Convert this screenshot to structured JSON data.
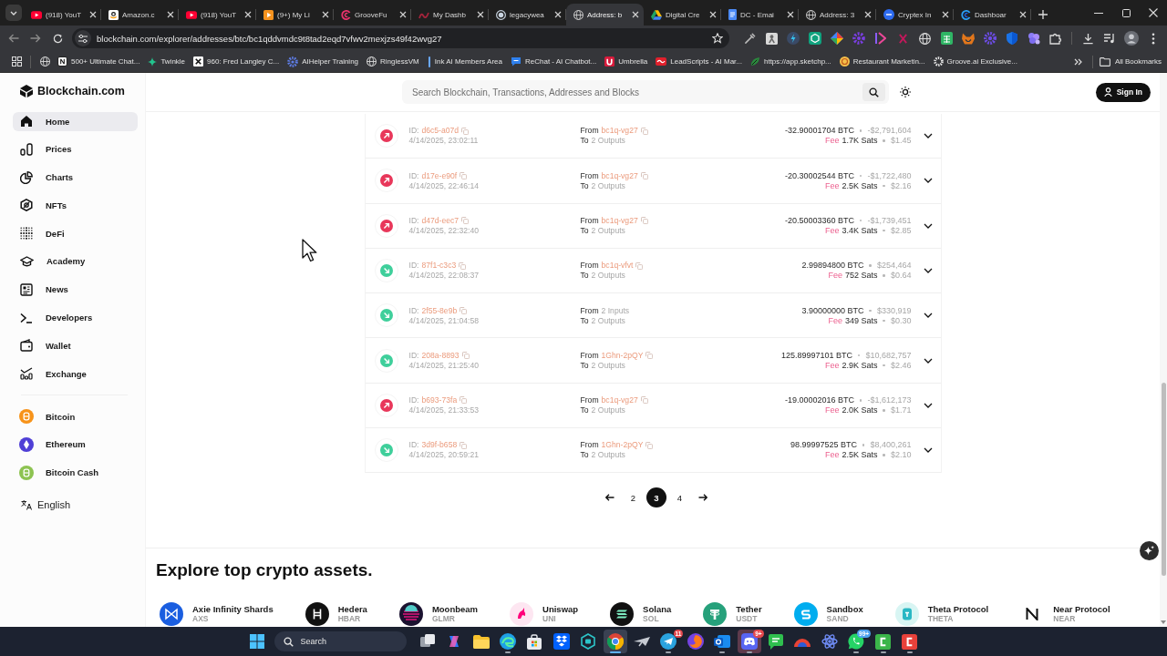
{
  "browser": {
    "tabs": [
      {
        "label": "(918) YouT",
        "selected": false
      },
      {
        "label": "Amazon.c",
        "selected": false
      },
      {
        "label": "(918) YouT",
        "selected": false
      },
      {
        "label": "(9+) My Li",
        "selected": false
      },
      {
        "label": "GrooveFu",
        "selected": false
      },
      {
        "label": "My Dashb",
        "selected": false
      },
      {
        "label": "legacywea",
        "selected": false
      },
      {
        "label": "Address: b",
        "selected": true
      },
      {
        "label": "Digital Cre",
        "selected": false
      },
      {
        "label": "DC - Emai",
        "selected": false
      },
      {
        "label": "Address: 3",
        "selected": false
      },
      {
        "label": "Cryptex In",
        "selected": false
      },
      {
        "label": "Dashboar",
        "selected": false
      }
    ],
    "url": "blockchain.com/explorer/addresses/btc/bc1qddvmdc9t8tad2eqd7vfwv2mexjzs49f42wvg27",
    "bookmarks": [
      "500+ Ultimate Chat...",
      "Twinkle",
      "960: Fred Langley C...",
      "AIHelper Training",
      "RinglessVM",
      "Ink AI Members Area",
      "ReChat - AI Chatbot...",
      "Umbrella",
      "LeadScripts - AI Mar...",
      "https://app.sketchp...",
      "Restaurant Marketin...",
      "Groove.ai Exclusive..."
    ],
    "all_bookmarks": "All Bookmarks"
  },
  "sidebar": {
    "logo": "Blockchain.com",
    "items": [
      {
        "label": "Home",
        "selected": true
      },
      {
        "label": "Prices",
        "selected": false
      },
      {
        "label": "Charts",
        "selected": false
      },
      {
        "label": "NFTs",
        "selected": false
      },
      {
        "label": "DeFi",
        "selected": false
      },
      {
        "label": "Academy",
        "selected": false
      },
      {
        "label": "News",
        "selected": false
      },
      {
        "label": "Developers",
        "selected": false
      },
      {
        "label": "Wallet",
        "selected": false
      },
      {
        "label": "Exchange",
        "selected": false
      }
    ],
    "coins": [
      {
        "name": "Bitcoin",
        "color": "#f7931a"
      },
      {
        "name": "Ethereum",
        "color": "#4f3fd6"
      },
      {
        "name": "Bitcoin Cash",
        "color": "#8dc351"
      }
    ],
    "language": "English"
  },
  "header": {
    "search": {
      "placeholder": "Search Blockchain, Transactions, Addresses and Blocks"
    },
    "sign_in": "Sign In"
  },
  "transactions": [
    {
      "kind": "sent",
      "id_label": "ID:",
      "id": "d6c5-a07d",
      "time": "4/14/2025, 23:02:11",
      "from_label": "From",
      "from": "bc1q-vg27",
      "from_is_address": true,
      "to_label": "To",
      "to": "2 Outputs",
      "amount": "-32.90001704 BTC",
      "value": "-$2,791,604",
      "fee_label": "Fee",
      "fee": "1.7K Sats",
      "fee_value": "$1.45",
      "expanded": false
    },
    {
      "kind": "sent",
      "id_label": "ID:",
      "id": "d17e-e90f",
      "time": "4/14/2025, 22:46:14",
      "from_label": "From",
      "from": "bc1q-vg27",
      "from_is_address": true,
      "to_label": "To",
      "to": "2 Outputs",
      "amount": "-20.30002544 BTC",
      "value": "-$1,722,480",
      "fee_label": "Fee",
      "fee": "2.5K Sats",
      "fee_value": "$2.16",
      "expanded": false
    },
    {
      "kind": "sent",
      "id_label": "ID:",
      "id": "d47d-eec7",
      "time": "4/14/2025, 22:32:40",
      "from_label": "From",
      "from": "bc1q-vg27",
      "from_is_address": true,
      "to_label": "To",
      "to": "2 Outputs",
      "amount": "-20.50003360 BTC",
      "value": "-$1,739,451",
      "fee_label": "Fee",
      "fee": "3.4K Sats",
      "fee_value": "$2.85",
      "expanded": false
    },
    {
      "kind": "received",
      "id_label": "ID:",
      "id": "87f1-c3c3",
      "time": "4/14/2025, 22:08:37",
      "from_label": "From",
      "from": "bc1q-vfvt",
      "from_is_address": true,
      "to_label": "To",
      "to": "2 Outputs",
      "amount": "2.99894800 BTC",
      "value": "$254,464",
      "fee_label": "Fee",
      "fee": "752 Sats",
      "fee_value": "$0.64",
      "expanded": false
    },
    {
      "kind": "received",
      "id_label": "ID:",
      "id": "2f55-8e9b",
      "time": "4/14/2025, 21:04:58",
      "from_label": "From",
      "from": "2 Inputs",
      "from_is_address": false,
      "to_label": "To",
      "to": "2 Outputs",
      "amount": "3.90000000 BTC",
      "value": "$330,919",
      "fee_label": "Fee",
      "fee": "349 Sats",
      "fee_value": "$0.30",
      "expanded": false
    },
    {
      "kind": "received",
      "id_label": "ID:",
      "id": "208a-8893",
      "time": "4/14/2025, 21:25:40",
      "from_label": "From",
      "from": "1Ghn-2pQY",
      "from_is_address": true,
      "to_label": "To",
      "to": "2 Outputs",
      "amount": "125.89997101 BTC",
      "value": "$10,682,757",
      "fee_label": "Fee",
      "fee": "2.9K Sats",
      "fee_value": "$2.46",
      "expanded": false
    },
    {
      "kind": "sent",
      "id_label": "ID:",
      "id": "b693-73fa",
      "time": "4/14/2025, 21:33:53",
      "from_label": "From",
      "from": "bc1q-vg27",
      "from_is_address": true,
      "to_label": "To",
      "to": "2 Outputs",
      "amount": "-19.00002016 BTC",
      "value": "-$1,612,173",
      "fee_label": "Fee",
      "fee": "2.0K Sats",
      "fee_value": "$1.71",
      "expanded": false
    },
    {
      "kind": "received",
      "id_label": "ID:",
      "id": "3d9f-b658",
      "time": "4/14/2025, 20:59:21",
      "from_label": "From",
      "from": "1Ghn-2pQY",
      "from_is_address": true,
      "to_label": "To",
      "to": "2 Outputs",
      "amount": "98.99997525 BTC",
      "value": "$8,400,261",
      "fee_label": "Fee",
      "fee": "2.5K Sats",
      "fee_value": "$2.10",
      "expanded": false
    }
  ],
  "pagination": {
    "pages": [
      {
        "label": "2",
        "selected": false
      },
      {
        "label": "3",
        "selected": true
      },
      {
        "label": "4",
        "selected": false
      }
    ]
  },
  "explore": {
    "title": "Explore top crypto assets.",
    "assets": [
      {
        "name": "Axie Infinity Shards",
        "ticker": "AXS"
      },
      {
        "name": "Hedera",
        "ticker": "HBAR"
      },
      {
        "name": "Moonbeam",
        "ticker": "GLMR"
      },
      {
        "name": "Uniswap",
        "ticker": "UNI"
      },
      {
        "name": "Solana",
        "ticker": "SOL"
      },
      {
        "name": "Tether",
        "ticker": "USDT"
      },
      {
        "name": "Sandbox",
        "ticker": "SAND"
      },
      {
        "name": "Theta Protocol",
        "ticker": "THETA"
      },
      {
        "name": "Near Protocol",
        "ticker": "NEAR"
      }
    ]
  },
  "taskbar": {
    "search": {
      "placeholder": "Search"
    },
    "apps": [
      {
        "active": false,
        "running": false,
        "flashing": false
      },
      {
        "active": false,
        "running": false,
        "flashing": false
      },
      {
        "active": false,
        "running": false,
        "flashing": false
      },
      {
        "active": false,
        "running": true,
        "flashing": false
      },
      {
        "active": false,
        "running": false,
        "flashing": false
      },
      {
        "active": false,
        "running": false,
        "flashing": false
      },
      {
        "active": false,
        "running": false,
        "flashing": false
      },
      {
        "active": true,
        "running": true,
        "flashing": false
      },
      {
        "active": false,
        "running": false,
        "flashing": false
      },
      {
        "active": false,
        "running": true,
        "flashing": false,
        "badge": {
          "text": "11",
          "color": "#e5484d"
        }
      },
      {
        "active": false,
        "running": false,
        "flashing": false
      },
      {
        "active": false,
        "running": true,
        "flashing": false
      },
      {
        "active": false,
        "running": true,
        "flashing": true,
        "badge": {
          "text": "9+",
          "color": "#e5484d"
        }
      },
      {
        "active": false,
        "running": false,
        "flashing": false
      },
      {
        "active": false,
        "running": false,
        "flashing": false
      },
      {
        "active": false,
        "running": false,
        "flashing": false
      },
      {
        "active": false,
        "running": true,
        "flashing": false,
        "badge": {
          "text": "99+",
          "color": "#4fa3f0"
        }
      },
      {
        "active": false,
        "running": true,
        "flashing": false
      },
      {
        "active": false,
        "running": true,
        "flashing": false
      }
    ]
  }
}
